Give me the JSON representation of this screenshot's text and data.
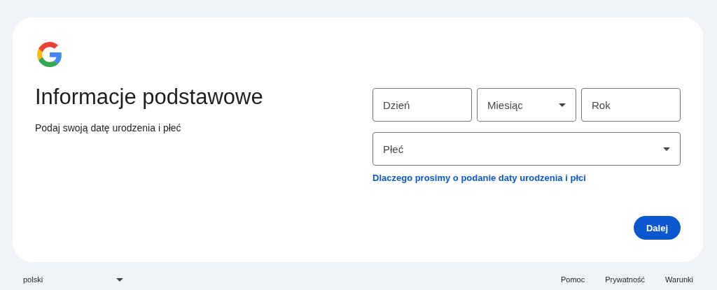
{
  "heading": "Informacje podstawowe",
  "subtitle": "Podaj swoją datę urodzenia i płeć",
  "date_fields": [
    {
      "kind": "text",
      "placeholder": "Dzień"
    },
    {
      "kind": "select",
      "placeholder": "Miesiąc"
    },
    {
      "kind": "text",
      "placeholder": "Rok"
    }
  ],
  "gender_field": {
    "kind": "select",
    "placeholder": "Płeć"
  },
  "help_link": "Dlaczego prosimy o podanie daty urodzenia i płci",
  "next_button": "Dalej",
  "footer": {
    "language": "polski",
    "links": [
      "Pomoc",
      "Prywatność",
      "Warunki"
    ]
  }
}
